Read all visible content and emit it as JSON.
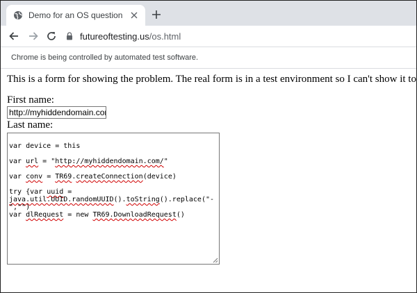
{
  "browser": {
    "tab": {
      "title": "Demo for an OS question"
    },
    "address": {
      "host": "futureoftesting.us",
      "path": "/os.html"
    },
    "infobar": {
      "text": "Chrome is being controlled by automated test software."
    }
  },
  "page": {
    "intro": "This is a form for showing the problem. The real form is in a test environment so I can't show it to you...",
    "first_name_label": "First name:",
    "first_name_value": "http://myhiddendomain.com/",
    "last_name_label": "Last name:",
    "code": {
      "l1": "var device = this",
      "l2_a": "var ",
      "l2_b": "url",
      "l2_c": " = \"",
      "l2_d": "http://myhiddendomain.com/",
      "l2_e": "\"",
      "l3_a": "var ",
      "l3_b": "conv",
      "l3_c": " = ",
      "l3_d": "TR69",
      "l3_e": ".",
      "l3_f": "createConnection",
      "l3_g": "(device)",
      "l4_a": "try {var ",
      "l4_b": "uuid",
      "l4_c": " =",
      "l5_a": "java.util.UUID.randomUUID",
      "l5_b": "().",
      "l5_c": "toString",
      "l5_d": "().replace(\"-",
      "l6": "\",\"\")",
      "l7_a": "var ",
      "l7_b": "dlRequest",
      "l7_c": " = new ",
      "l7_d": "TR69.DownloadRequest",
      "l7_e": "()"
    }
  },
  "colors": {
    "tabstrip": "#dee1e6",
    "squiggle": "#d00000"
  }
}
